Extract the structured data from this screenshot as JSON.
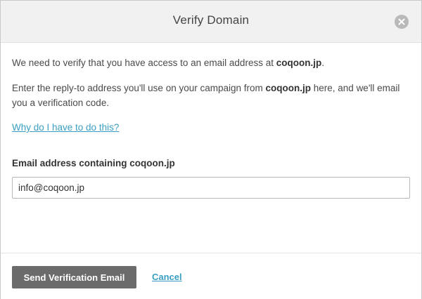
{
  "dialog": {
    "title": "Verify Domain",
    "close_icon": "close-circle-icon"
  },
  "message": {
    "line1_prefix": "We need to verify that you have access to an email address at ",
    "domain": "coqoon.jp",
    "line1_suffix": ".",
    "line2_prefix": "Enter the reply-to address you'll use on your campaign from ",
    "line2_suffix": " here, and we'll email you a verification code."
  },
  "help_link": "Why do I have to do this?",
  "field": {
    "label": "Email address containing coqoon.jp",
    "value": "info@coqoon.jp",
    "placeholder": ""
  },
  "footer": {
    "send_label": "Send Verification Email",
    "cancel_label": "Cancel"
  },
  "colors": {
    "header_bg": "#f1f1f1",
    "link": "#3a9fc2",
    "primary_button": "#6b6b6b",
    "close_icon": "#b9b9b9"
  }
}
